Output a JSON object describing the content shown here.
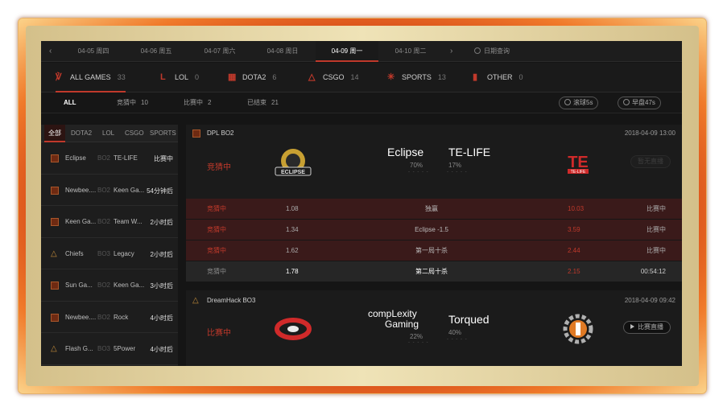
{
  "date_tabs": [
    {
      "label": "04-05 周四"
    },
    {
      "label": "04-06 周五"
    },
    {
      "label": "04-07 周六"
    },
    {
      "label": "04-08 周日"
    },
    {
      "label": "04-09 周一"
    },
    {
      "label": "04-10 周二"
    }
  ],
  "date_query_label": "日期查询",
  "game_tabs": [
    {
      "label": "ALL GAMES",
      "count": "33",
      "icon": "all-games-icon"
    },
    {
      "label": "LOL",
      "count": "0",
      "icon": "lol-icon"
    },
    {
      "label": "DOTA2",
      "count": "6",
      "icon": "dota2-icon"
    },
    {
      "label": "CSGO",
      "count": "14",
      "icon": "csgo-icon"
    },
    {
      "label": "SPORTS",
      "count": "13",
      "icon": "sports-icon"
    },
    {
      "label": "OTHER",
      "count": "0",
      "icon": "other-icon"
    }
  ],
  "status_tabs": [
    {
      "label": "ALL",
      "count": ""
    },
    {
      "label": "竞猜中",
      "count": "10"
    },
    {
      "label": "比赛中",
      "count": "2"
    },
    {
      "label": "已结束",
      "count": "21"
    }
  ],
  "pill_buttons": {
    "rolling": "滚球5s",
    "early": "早盘47s"
  },
  "sidebar_tabs": [
    "全部",
    "DOTA2",
    "LOL",
    "CSGO",
    "SPORTS"
  ],
  "sidebar_matches": [
    {
      "game": "dota2",
      "team1": "Eclipse",
      "format": "BO2",
      "team2": "TE-LIFE",
      "status": "比赛中"
    },
    {
      "game": "dota2",
      "team1": "Newbee....",
      "format": "BO2",
      "team2": "Keen Ga...",
      "status": "54分钟后"
    },
    {
      "game": "dota2",
      "team1": "Keen Ga...",
      "format": "BO2",
      "team2": "Team W...",
      "status": "2小时后"
    },
    {
      "game": "csgo",
      "team1": "Chiefs",
      "format": "BO3",
      "team2": "Legacy",
      "status": "2小时后"
    },
    {
      "game": "dota2",
      "team1": "Sun Ga...",
      "format": "BO2",
      "team2": "Keen Ga...",
      "status": "3小时后"
    },
    {
      "game": "dota2",
      "team1": "Newbee....",
      "format": "BO2",
      "team2": "Rock",
      "status": "4小时后"
    },
    {
      "game": "csgo",
      "team1": "Flash G...",
      "format": "BO3",
      "team2": "5Power",
      "status": "4小时后"
    }
  ],
  "match1": {
    "league": "DPL BO2",
    "time": "2018-04-09 13:00",
    "state": "竞猜中",
    "team1": "Eclipse",
    "team1_pct": "70%",
    "team2": "TE-LIFE",
    "team2_pct": "17%",
    "live_btn": "暂无直播",
    "team1_logo_text": "ECLIPSE",
    "team2_logo_text": "TE-LIFE",
    "bets": [
      {
        "state": "竞猜中",
        "odds1": "1.08",
        "market": "独赢",
        "odds2": "10.03",
        "right": "比赛中",
        "style": "red"
      },
      {
        "state": "竞猜中",
        "odds1": "1.34",
        "market": "Eclipse -1.5",
        "odds2": "3.59",
        "right": "比赛中",
        "style": "red"
      },
      {
        "state": "竞猜中",
        "odds1": "1.62",
        "market": "第一局十杀",
        "odds2": "2.44",
        "right": "比赛中",
        "style": "red"
      },
      {
        "state": "竞猜中",
        "odds1": "1.78",
        "market": "第二局十杀",
        "odds2": "2.15",
        "right": "00:54:12",
        "style": "dark"
      }
    ]
  },
  "match2": {
    "league": "DreamHack BO3",
    "time": "2018-04-09 09:42",
    "state": "比赛中",
    "team1_line1": "compLexity",
    "team1_line2": "Gaming",
    "team1_pct": "22%",
    "team2": "Torqued",
    "team2_pct": "40%",
    "live_btn": "比赛直播"
  },
  "colors": {
    "accent": "#c0392b",
    "bg": "#151515",
    "panel": "#1b1b1b"
  }
}
